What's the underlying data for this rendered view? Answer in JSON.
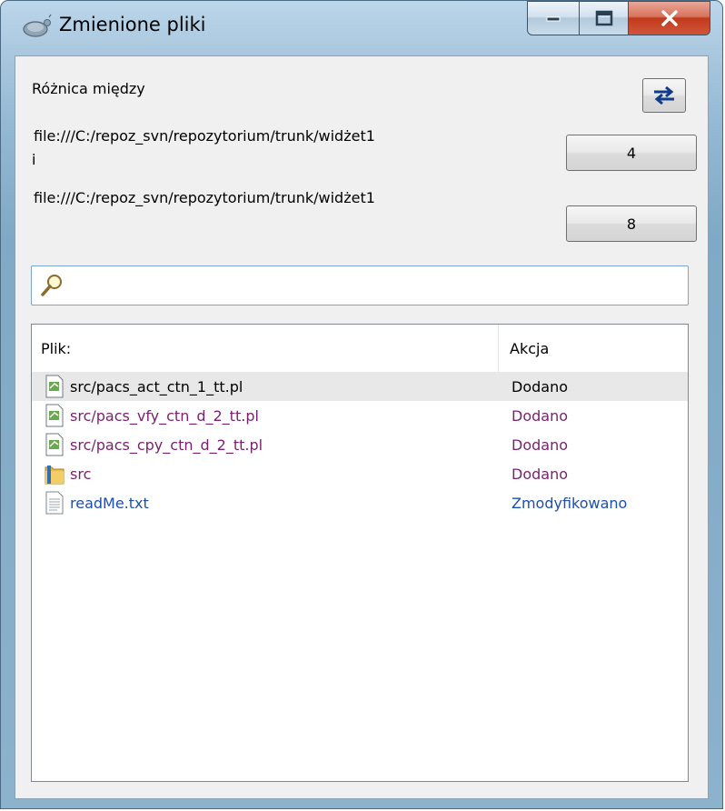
{
  "window": {
    "title": "Zmienione pliki"
  },
  "header": {
    "diff_label": "Różnica między",
    "path1": "file:///C:/repoz_svn/repozytorium/trunk/widżet1",
    "rev1": "4",
    "conjunction": "i",
    "path2": "file:///C:/repoz_svn/repozytorium/trunk/widżet1",
    "rev2": "8"
  },
  "search": {
    "value": "",
    "placeholder": ""
  },
  "list": {
    "columns": [
      "Plik:",
      "Akcja"
    ],
    "rows": [
      {
        "file": "src/pacs_act_ctn_1_tt.pl",
        "action": "Dodano",
        "icon": "perl-file-icon",
        "color": "#000000",
        "selected": true
      },
      {
        "file": "src/pacs_vfy_ctn_d_2_tt.pl",
        "action": "Dodano",
        "icon": "perl-file-icon",
        "color": "#7a1f6e",
        "selected": false
      },
      {
        "file": "src/pacs_cpy_ctn_d_2_tt.pl",
        "action": "Dodano",
        "icon": "perl-file-icon",
        "color": "#7a1f6e",
        "selected": false
      },
      {
        "file": "src",
        "action": "Dodano",
        "icon": "folder-icon",
        "color": "#7a1f6e",
        "selected": false
      },
      {
        "file": "readMe.txt",
        "action": "Zmodyfikowano",
        "icon": "text-file-icon",
        "color": "#1c4fb0",
        "selected": false
      }
    ]
  },
  "colors": {
    "added": "#7a1f6e",
    "modified": "#1c4fb0",
    "accent": "#1c4fb0"
  }
}
